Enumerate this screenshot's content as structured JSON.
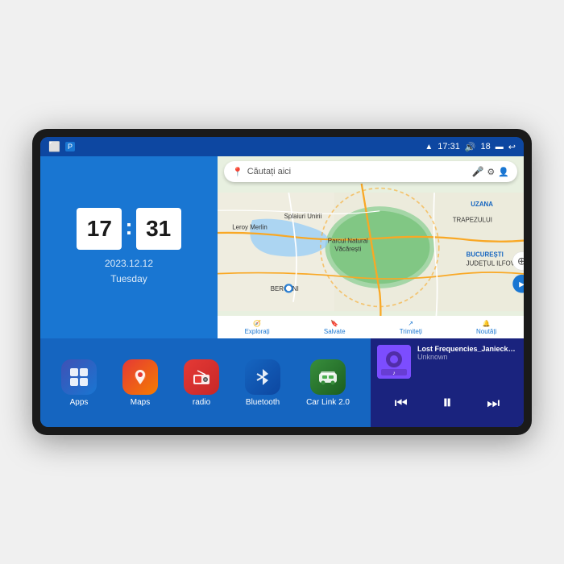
{
  "device": {
    "screen_bg": "#1565c0"
  },
  "status_bar": {
    "time": "17:31",
    "battery": "18",
    "left_icons": [
      "⬜",
      "P"
    ],
    "signal_icon": "📶",
    "battery_icon": "🔋",
    "back_icon": "↩"
  },
  "clock": {
    "hours": "17",
    "minutes": "31",
    "date": "2023.12.12",
    "day": "Tuesday"
  },
  "map": {
    "search_placeholder": "Căutați aici",
    "bottom_items": [
      {
        "icon": "🧭",
        "label": "Explorați"
      },
      {
        "icon": "🔖",
        "label": "Salvate"
      },
      {
        "icon": "↗",
        "label": "Trimiteți"
      },
      {
        "icon": "🔔",
        "label": "Noutăți"
      }
    ],
    "labels": [
      "UZANA",
      "TRAPEZULUI",
      "Parcul Natural Văcărești",
      "BUCUREȘTI",
      "JUDEȚUL ILFOV",
      "BERCENI",
      "Leroy Merlin",
      "Splaiuri Unirii"
    ]
  },
  "apps": [
    {
      "id": "apps",
      "label": "Apps",
      "icon": "⊞",
      "color_class": "icon-apps"
    },
    {
      "id": "maps",
      "label": "Maps",
      "icon": "📍",
      "color_class": "icon-maps"
    },
    {
      "id": "radio",
      "label": "radio",
      "icon": "📻",
      "color_class": "icon-radio"
    },
    {
      "id": "bluetooth",
      "label": "Bluetooth",
      "icon": "⚡",
      "color_class": "icon-bluetooth"
    },
    {
      "id": "carlink",
      "label": "Car Link 2.0",
      "icon": "🚗",
      "color_class": "icon-carlink"
    }
  ],
  "music": {
    "title": "Lost Frequencies_Janieck Devy-...",
    "artist": "Unknown",
    "thumb_emoji": "🎵"
  }
}
